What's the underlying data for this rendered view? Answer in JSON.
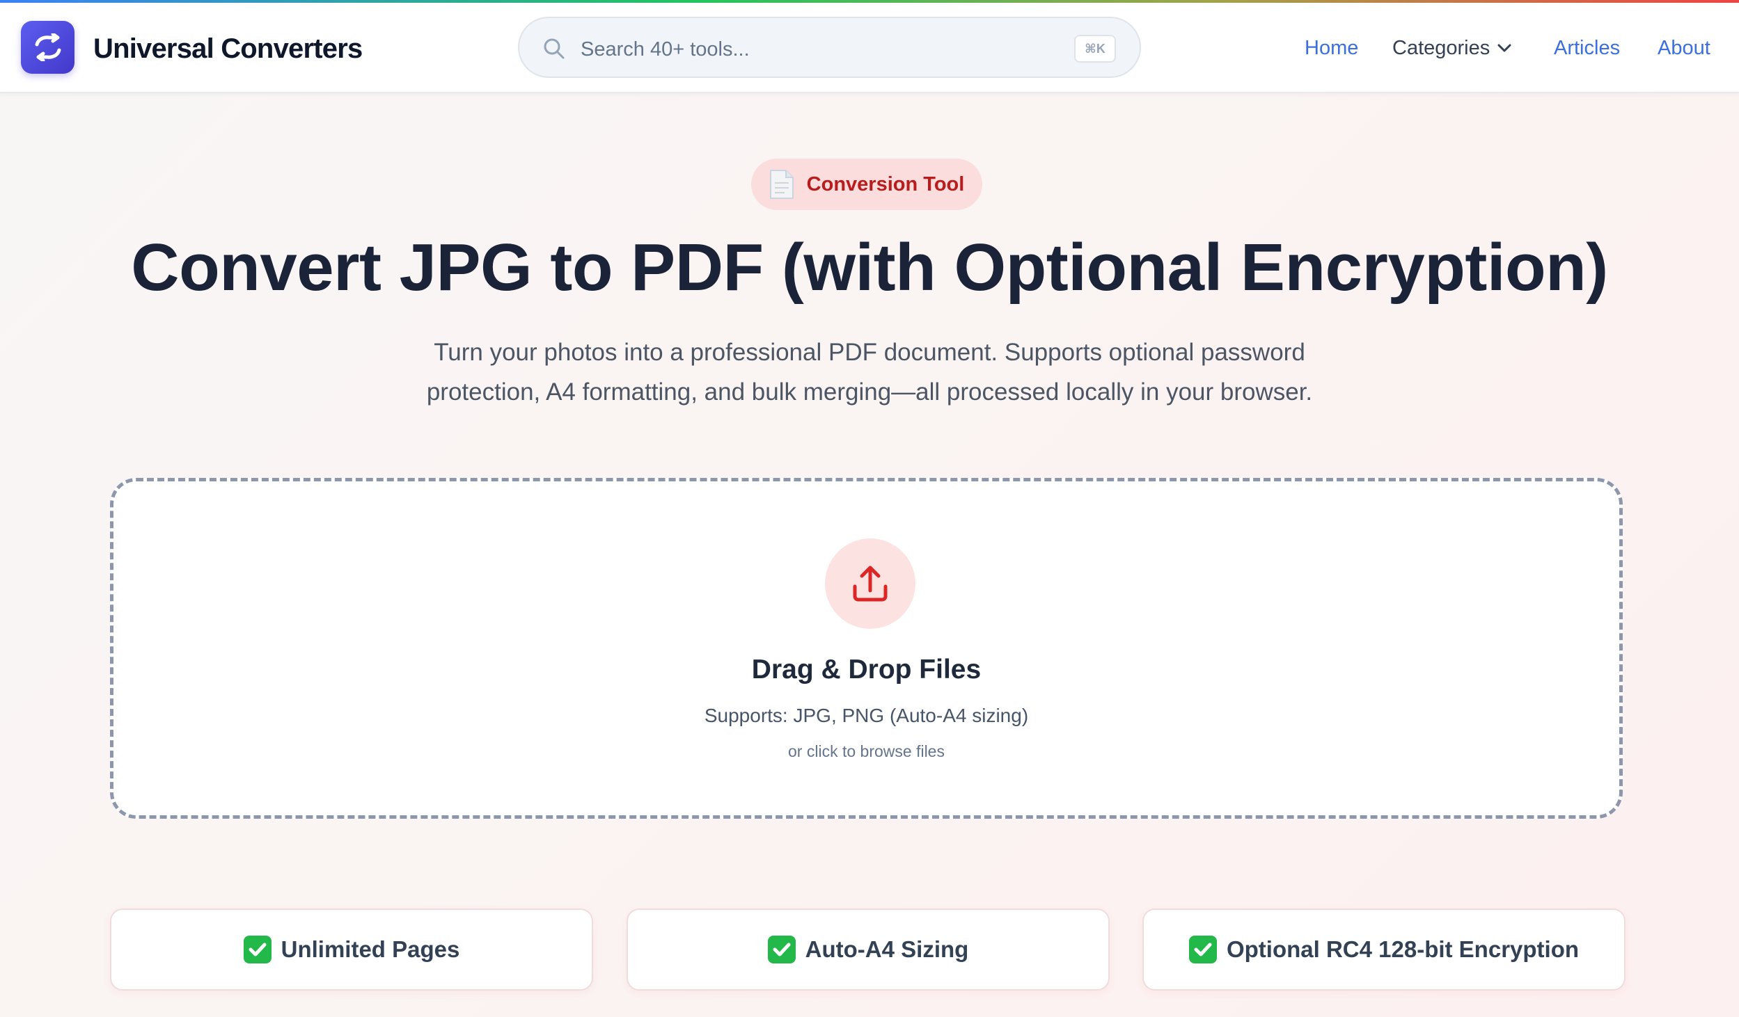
{
  "header": {
    "brand": "Universal Converters",
    "search": {
      "placeholder": "Search 40+ tools...",
      "shortcut": "⌘K"
    },
    "nav": {
      "home": "Home",
      "categories": "Categories",
      "articles": "Articles",
      "about": "About"
    }
  },
  "hero": {
    "badge": "Conversion Tool",
    "title": "Convert JPG to PDF (with Optional Encryption)",
    "subtitle": "Turn your photos into a professional PDF document. Supports optional password protection, A4 formatting, and bulk merging—all processed locally in your browser."
  },
  "dropzone": {
    "title": "Drag & Drop Files",
    "supports": "Supports: JPG, PNG (Auto-A4 sizing)",
    "browse": "or click to browse files"
  },
  "features": [
    {
      "label": "Unlimited Pages"
    },
    {
      "label": "Auto-A4 Sizing"
    },
    {
      "label": "Optional RC4 128-bit Encryption"
    }
  ],
  "colors": {
    "accent": "#4f46e5",
    "link": "#3b6fe0",
    "badge_bg": "#fbdddd",
    "badge_text": "#b91c1c",
    "check": "#22b84a"
  }
}
